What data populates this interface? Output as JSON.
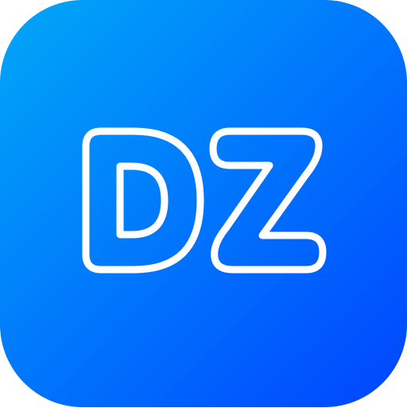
{
  "icon": {
    "glyph_text": "DZ",
    "gradient_start": "#00A8F8",
    "gradient_end": "#0044FF",
    "outline_color": "#FFFFFF"
  }
}
